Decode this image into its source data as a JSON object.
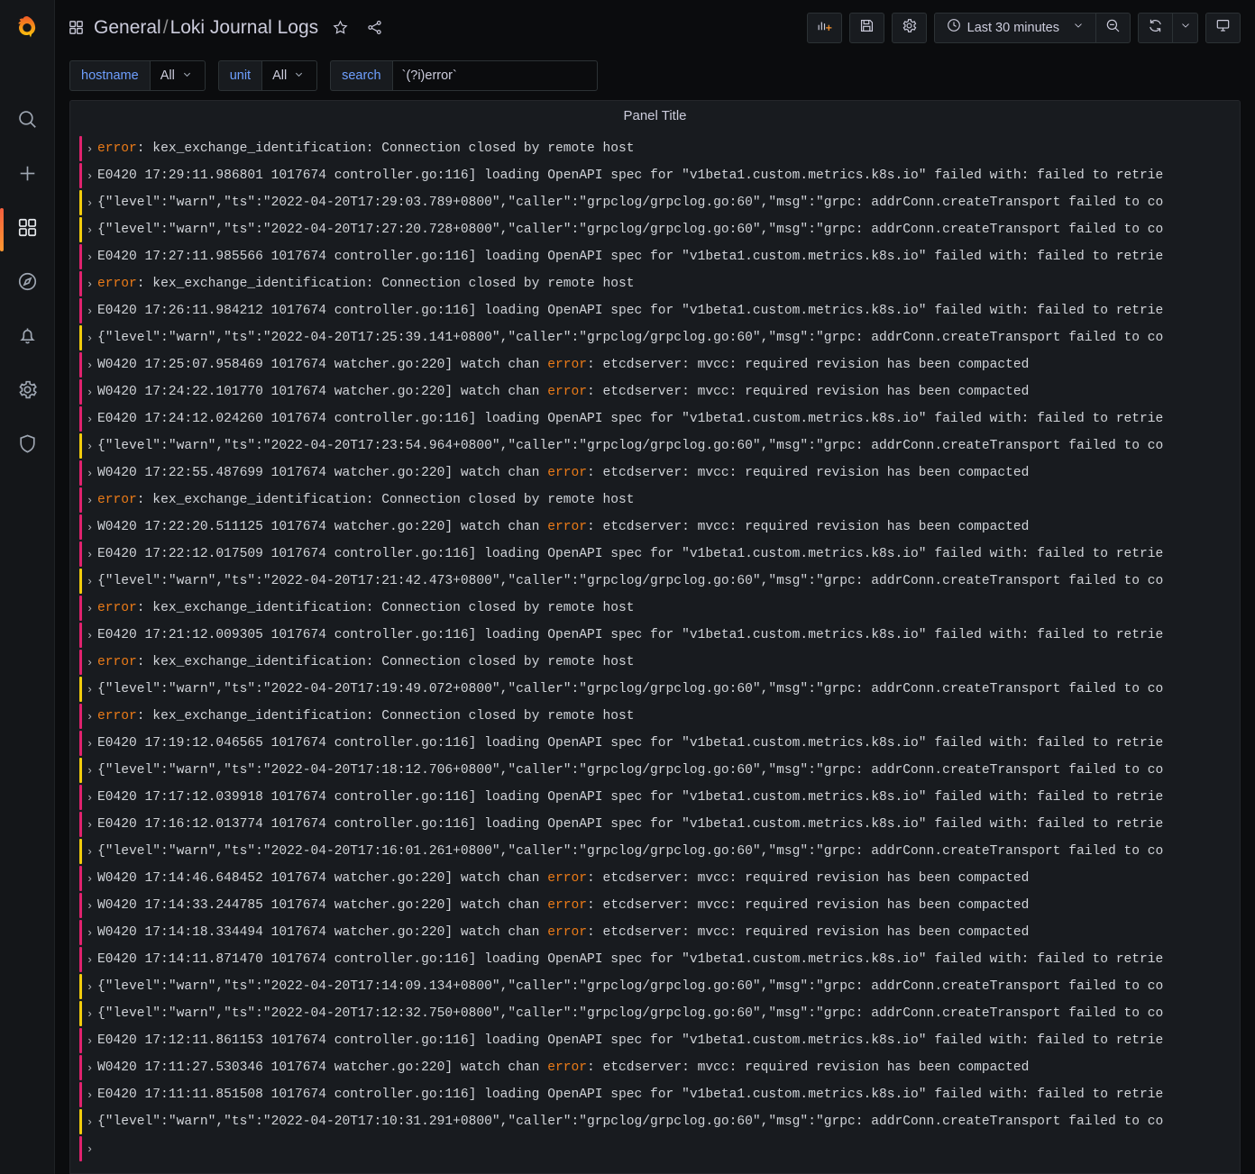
{
  "brand": {
    "logo_name": "grafana-logo"
  },
  "sidebar": {
    "items": [
      {
        "name": "search",
        "icon": "search-icon",
        "active": false
      },
      {
        "name": "create",
        "icon": "plus-icon",
        "active": false
      },
      {
        "name": "dashboards",
        "icon": "apps-icon",
        "active": true
      },
      {
        "name": "explore",
        "icon": "compass-icon",
        "active": false
      },
      {
        "name": "alerting",
        "icon": "bell-icon",
        "active": false
      },
      {
        "name": "configuration",
        "icon": "gear-icon",
        "active": false
      },
      {
        "name": "server-admin",
        "icon": "shield-icon",
        "active": false
      }
    ]
  },
  "navbar": {
    "folder": "General",
    "separator": "/",
    "dashboard": "Loki Journal Logs",
    "star_icon": "star-icon",
    "share_icon": "share-icon",
    "actions": [
      {
        "name": "add-panel-button",
        "icon": "add-panel-icon"
      },
      {
        "name": "save-dashboard-button",
        "icon": "save-icon"
      },
      {
        "name": "dashboard-settings-button",
        "icon": "gear-icon"
      }
    ],
    "time_picker": {
      "icon": "clock-icon",
      "label": "Last 30 minutes",
      "caret": "chevron-down-icon"
    },
    "zoom_out": {
      "name": "zoom-out-time-range-button",
      "icon": "zoom-out-icon"
    },
    "refresh": {
      "name": "refresh-button",
      "icon": "refresh-icon"
    },
    "refresh_interval": {
      "name": "refresh-interval-picker",
      "icon": "chevron-down-icon"
    },
    "kiosk": {
      "name": "tv-mode-button",
      "icon": "monitor-icon"
    }
  },
  "variables": [
    {
      "label": "hostname",
      "value": "All",
      "type": "select",
      "name": "hostname"
    },
    {
      "label": "unit",
      "value": "All",
      "type": "select",
      "name": "unit"
    },
    {
      "label": "search",
      "value": "`(?i)error`",
      "type": "textbox",
      "name": "search"
    }
  ],
  "panel": {
    "title": "Panel Title",
    "logs": [
      {
        "level": "error",
        "segments": [
          {
            "t": "error",
            "hl": true
          },
          {
            "t": ": kex_exchange_identification: Connection closed by remote host"
          }
        ]
      },
      {
        "level": "error",
        "segments": [
          {
            "t": "E0420 17:29:11.986801 1017674 controller.go:116] loading OpenAPI spec for \"v1beta1.custom.metrics.k8s.io\" failed with: failed to retrie"
          }
        ]
      },
      {
        "level": "warn",
        "segments": [
          {
            "t": "{\"level\":\"warn\",\"ts\":\"2022-04-20T17:29:03.789+0800\",\"caller\":\"grpclog/grpclog.go:60\",\"msg\":\"grpc: addrConn.createTransport failed to co"
          }
        ]
      },
      {
        "level": "warn",
        "segments": [
          {
            "t": "{\"level\":\"warn\",\"ts\":\"2022-04-20T17:27:20.728+0800\",\"caller\":\"grpclog/grpclog.go:60\",\"msg\":\"grpc: addrConn.createTransport failed to co"
          }
        ]
      },
      {
        "level": "error",
        "segments": [
          {
            "t": "E0420 17:27:11.985566 1017674 controller.go:116] loading OpenAPI spec for \"v1beta1.custom.metrics.k8s.io\" failed with: failed to retrie"
          }
        ]
      },
      {
        "level": "error",
        "segments": [
          {
            "t": "error",
            "hl": true
          },
          {
            "t": ": kex_exchange_identification: Connection closed by remote host"
          }
        ]
      },
      {
        "level": "error",
        "segments": [
          {
            "t": "E0420 17:26:11.984212 1017674 controller.go:116] loading OpenAPI spec for \"v1beta1.custom.metrics.k8s.io\" failed with: failed to retrie"
          }
        ]
      },
      {
        "level": "warn",
        "segments": [
          {
            "t": "{\"level\":\"warn\",\"ts\":\"2022-04-20T17:25:39.141+0800\",\"caller\":\"grpclog/grpclog.go:60\",\"msg\":\"grpc: addrConn.createTransport failed to co"
          }
        ]
      },
      {
        "level": "error",
        "segments": [
          {
            "t": "W0420 17:25:07.958469 1017674 watcher.go:220] watch chan "
          },
          {
            "t": "error",
            "hl": true
          },
          {
            "t": ": etcdserver: mvcc: required revision has been compacted"
          }
        ]
      },
      {
        "level": "error",
        "segments": [
          {
            "t": "W0420 17:24:22.101770 1017674 watcher.go:220] watch chan "
          },
          {
            "t": "error",
            "hl": true
          },
          {
            "t": ": etcdserver: mvcc: required revision has been compacted"
          }
        ]
      },
      {
        "level": "error",
        "segments": [
          {
            "t": "E0420 17:24:12.024260 1017674 controller.go:116] loading OpenAPI spec for \"v1beta1.custom.metrics.k8s.io\" failed with: failed to retrie"
          }
        ]
      },
      {
        "level": "warn",
        "segments": [
          {
            "t": "{\"level\":\"warn\",\"ts\":\"2022-04-20T17:23:54.964+0800\",\"caller\":\"grpclog/grpclog.go:60\",\"msg\":\"grpc: addrConn.createTransport failed to co"
          }
        ]
      },
      {
        "level": "error",
        "segments": [
          {
            "t": "W0420 17:22:55.487699 1017674 watcher.go:220] watch chan "
          },
          {
            "t": "error",
            "hl": true
          },
          {
            "t": ": etcdserver: mvcc: required revision has been compacted"
          }
        ]
      },
      {
        "level": "error",
        "segments": [
          {
            "t": "error",
            "hl": true
          },
          {
            "t": ": kex_exchange_identification: Connection closed by remote host"
          }
        ]
      },
      {
        "level": "error",
        "segments": [
          {
            "t": "W0420 17:22:20.511125 1017674 watcher.go:220] watch chan "
          },
          {
            "t": "error",
            "hl": true
          },
          {
            "t": ": etcdserver: mvcc: required revision has been compacted"
          }
        ]
      },
      {
        "level": "error",
        "segments": [
          {
            "t": "E0420 17:22:12.017509 1017674 controller.go:116] loading OpenAPI spec for \"v1beta1.custom.metrics.k8s.io\" failed with: failed to retrie"
          }
        ]
      },
      {
        "level": "warn",
        "segments": [
          {
            "t": "{\"level\":\"warn\",\"ts\":\"2022-04-20T17:21:42.473+0800\",\"caller\":\"grpclog/grpclog.go:60\",\"msg\":\"grpc: addrConn.createTransport failed to co"
          }
        ]
      },
      {
        "level": "error",
        "segments": [
          {
            "t": "error",
            "hl": true
          },
          {
            "t": ": kex_exchange_identification: Connection closed by remote host"
          }
        ]
      },
      {
        "level": "error",
        "segments": [
          {
            "t": "E0420 17:21:12.009305 1017674 controller.go:116] loading OpenAPI spec for \"v1beta1.custom.metrics.k8s.io\" failed with: failed to retrie"
          }
        ]
      },
      {
        "level": "error",
        "segments": [
          {
            "t": "error",
            "hl": true
          },
          {
            "t": ": kex_exchange_identification: Connection closed by remote host"
          }
        ]
      },
      {
        "level": "warn",
        "segments": [
          {
            "t": "{\"level\":\"warn\",\"ts\":\"2022-04-20T17:19:49.072+0800\",\"caller\":\"grpclog/grpclog.go:60\",\"msg\":\"grpc: addrConn.createTransport failed to co"
          }
        ]
      },
      {
        "level": "error",
        "segments": [
          {
            "t": "error",
            "hl": true
          },
          {
            "t": ": kex_exchange_identification: Connection closed by remote host"
          }
        ]
      },
      {
        "level": "error",
        "segments": [
          {
            "t": "E0420 17:19:12.046565 1017674 controller.go:116] loading OpenAPI spec for \"v1beta1.custom.metrics.k8s.io\" failed with: failed to retrie"
          }
        ]
      },
      {
        "level": "warn",
        "segments": [
          {
            "t": "{\"level\":\"warn\",\"ts\":\"2022-04-20T17:18:12.706+0800\",\"caller\":\"grpclog/grpclog.go:60\",\"msg\":\"grpc: addrConn.createTransport failed to co"
          }
        ]
      },
      {
        "level": "error",
        "segments": [
          {
            "t": "E0420 17:17:12.039918 1017674 controller.go:116] loading OpenAPI spec for \"v1beta1.custom.metrics.k8s.io\" failed with: failed to retrie"
          }
        ]
      },
      {
        "level": "error",
        "segments": [
          {
            "t": "E0420 17:16:12.013774 1017674 controller.go:116] loading OpenAPI spec for \"v1beta1.custom.metrics.k8s.io\" failed with: failed to retrie"
          }
        ]
      },
      {
        "level": "warn",
        "segments": [
          {
            "t": "{\"level\":\"warn\",\"ts\":\"2022-04-20T17:16:01.261+0800\",\"caller\":\"grpclog/grpclog.go:60\",\"msg\":\"grpc: addrConn.createTransport failed to co"
          }
        ]
      },
      {
        "level": "error",
        "segments": [
          {
            "t": "W0420 17:14:46.648452 1017674 watcher.go:220] watch chan "
          },
          {
            "t": "error",
            "hl": true
          },
          {
            "t": ": etcdserver: mvcc: required revision has been compacted"
          }
        ]
      },
      {
        "level": "error",
        "segments": [
          {
            "t": "W0420 17:14:33.244785 1017674 watcher.go:220] watch chan "
          },
          {
            "t": "error",
            "hl": true
          },
          {
            "t": ": etcdserver: mvcc: required revision has been compacted"
          }
        ]
      },
      {
        "level": "error",
        "segments": [
          {
            "t": "W0420 17:14:18.334494 1017674 watcher.go:220] watch chan "
          },
          {
            "t": "error",
            "hl": true
          },
          {
            "t": ": etcdserver: mvcc: required revision has been compacted"
          }
        ]
      },
      {
        "level": "error",
        "segments": [
          {
            "t": "E0420 17:14:11.871470 1017674 controller.go:116] loading OpenAPI spec for \"v1beta1.custom.metrics.k8s.io\" failed with: failed to retrie"
          }
        ]
      },
      {
        "level": "warn",
        "segments": [
          {
            "t": "{\"level\":\"warn\",\"ts\":\"2022-04-20T17:14:09.134+0800\",\"caller\":\"grpclog/grpclog.go:60\",\"msg\":\"grpc: addrConn.createTransport failed to co"
          }
        ]
      },
      {
        "level": "warn",
        "segments": [
          {
            "t": "{\"level\":\"warn\",\"ts\":\"2022-04-20T17:12:32.750+0800\",\"caller\":\"grpclog/grpclog.go:60\",\"msg\":\"grpc: addrConn.createTransport failed to co"
          }
        ]
      },
      {
        "level": "error",
        "segments": [
          {
            "t": "E0420 17:12:11.861153 1017674 controller.go:116] loading OpenAPI spec for \"v1beta1.custom.metrics.k8s.io\" failed with: failed to retrie"
          }
        ]
      },
      {
        "level": "error",
        "segments": [
          {
            "t": "W0420 17:11:27.530346 1017674 watcher.go:220] watch chan "
          },
          {
            "t": "error",
            "hl": true
          },
          {
            "t": ": etcdserver: mvcc: required revision has been compacted"
          }
        ]
      },
      {
        "level": "error",
        "segments": [
          {
            "t": "E0420 17:11:11.851508 1017674 controller.go:116] loading OpenAPI spec for \"v1beta1.custom.metrics.k8s.io\" failed with: failed to retrie"
          }
        ]
      },
      {
        "level": "warn",
        "segments": [
          {
            "t": "{\"level\":\"warn\",\"ts\":\"2022-04-20T17:10:31.291+0800\",\"caller\":\"grpclog/grpclog.go:60\",\"msg\":\"grpc: addrConn.createTransport failed to co"
          }
        ]
      },
      {
        "level": "error",
        "segments": [
          {
            "t": ""
          }
        ]
      }
    ]
  },
  "colors": {
    "level_error": "#e0226e",
    "level_warn": "#f2cc0c",
    "highlight": "#eb7b18",
    "accent_blue": "#6e9fff",
    "panel_bg": "#181b1f",
    "page_bg": "#0b0c0e"
  },
  "glyphs": {
    "chevron_right": "›",
    "caret_down": "⌄"
  }
}
